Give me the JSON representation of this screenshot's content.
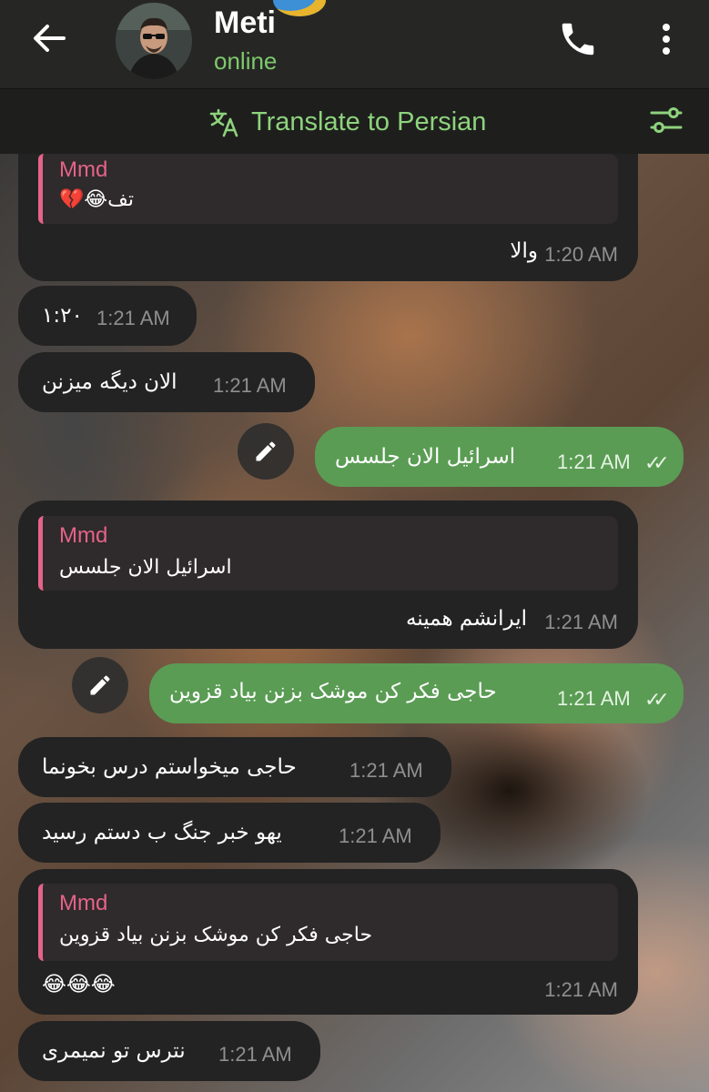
{
  "header": {
    "contact_name": "Meti",
    "status": "online",
    "back_icon": "arrow-left-icon",
    "call_icon": "phone-icon",
    "menu_icon": "more-vertical-icon"
  },
  "translate_bar": {
    "label": "Translate to Persian",
    "icon": "translate-icon",
    "options_icon": "sliders-icon"
  },
  "messages": [
    {
      "dir": "in",
      "reply_author": "Mmd",
      "reply_text": "تف😂💔",
      "text": "والا",
      "time": "1:20 AM"
    },
    {
      "dir": "in",
      "text": "۱:۲۰",
      "time": "1:21 AM"
    },
    {
      "dir": "in",
      "text": "الان دیگه میزنن",
      "time": "1:21 AM"
    },
    {
      "dir": "out",
      "text": "اسرائیل الان جلسس",
      "time": "1:21 AM",
      "status": "read"
    },
    {
      "dir": "in",
      "reply_author": "Mmd",
      "reply_text": "اسرائیل الان جلسس",
      "text": "ایرانشم همینه",
      "time": "1:21 AM"
    },
    {
      "dir": "out",
      "text": "حاجی فکر کن موشک بزنن بیاد قزوین",
      "time": "1:21 AM",
      "status": "read"
    },
    {
      "dir": "in",
      "text": "حاجی میخواستم درس بخونما",
      "time": "1:21 AM"
    },
    {
      "dir": "in",
      "text": "یهو خبر جنگ ب دستم رسید",
      "time": "1:21 AM"
    },
    {
      "dir": "in",
      "reply_author": "Mmd",
      "reply_text": "حاجی فکر کن موشک بزنن بیاد قزوین",
      "text": "😂😂😂",
      "time": "1:21 AM"
    },
    {
      "dir": "in",
      "text": "نترس تو نمیمری",
      "time": "1:21 AM"
    }
  ],
  "colors": {
    "accent": "#8ed37d",
    "outgoing_bubble": "#5a9c54",
    "incoming_bubble": "#232323",
    "reply_accent": "#e4638a",
    "header_bg": "#262725"
  }
}
